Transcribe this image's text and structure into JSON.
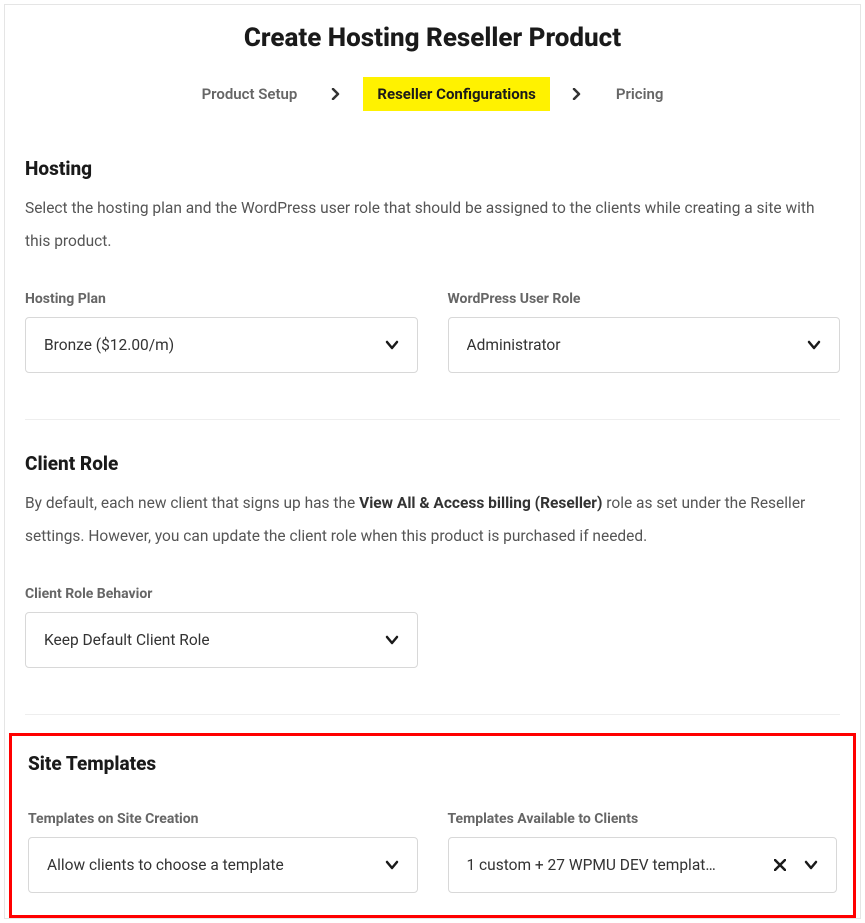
{
  "page_title": "Create Hosting Reseller Product",
  "breadcrumb": {
    "items": [
      {
        "label": "Product Setup",
        "active": false
      },
      {
        "label": "Reseller Configurations",
        "active": true
      },
      {
        "label": "Pricing",
        "active": false
      }
    ]
  },
  "hosting": {
    "title": "Hosting",
    "description": "Select the hosting plan and the WordPress user role that should be assigned to the clients while creating a site with this product.",
    "plan_label": "Hosting Plan",
    "plan_value": "Bronze ($12.00/m)",
    "role_label": "WordPress User Role",
    "role_value": "Administrator"
  },
  "client_role": {
    "title": "Client Role",
    "desc_before": "By default, each new client that signs up has the ",
    "desc_strong": "View All & Access billing (Reseller)",
    "desc_after": " role as set under the Reseller settings. However, you can update the client role when this product is purchased if needed.",
    "behavior_label": "Client Role Behavior",
    "behavior_value": "Keep Default Client Role"
  },
  "site_templates": {
    "title": "Site Templates",
    "creation_label": "Templates on Site Creation",
    "creation_value": "Allow clients to choose a template",
    "available_label": "Templates Available to Clients",
    "available_value": "1 custom + 27 WPMU DEV templat…"
  }
}
